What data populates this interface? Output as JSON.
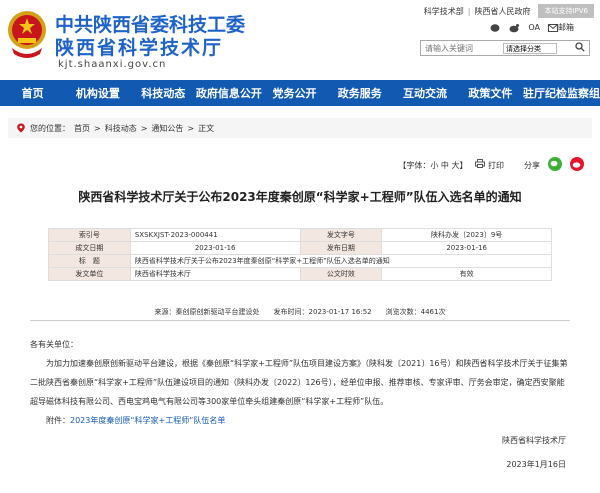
{
  "header": {
    "org_line1": "中共陕西省委科技工委",
    "org_line2": "陕西省科学技术厅",
    "domain": "kjt.shaanxi.gov.cn",
    "top_links": [
      "科学技术部",
      "陕西省人民政府"
    ],
    "ipv6_badge": "本站支持IPV6",
    "icon_labels": [
      "OA",
      "邮箱"
    ],
    "search_placeholder": "请输入关键词",
    "search_scope": "请选择分类"
  },
  "nav": [
    "首页",
    "机构设置",
    "科技动态",
    "政府信息公开",
    "党务公开",
    "政务服务",
    "互动交流",
    "政策文件",
    "驻厅纪检监察组"
  ],
  "breadcrumb": {
    "prefix": "您的位置：",
    "items": [
      "首页",
      "科技动态",
      "通知公告",
      "正文"
    ]
  },
  "tools": {
    "font_label": "【字体：",
    "small": "小",
    "medium": "中",
    "large": "大",
    "font_end": "】",
    "print": "打印",
    "share": "分享"
  },
  "article": {
    "title": "陕西省科学技术厅关于公布2023年度秦创原“科学家+工程师”队伍入选名单的通知",
    "meta_rows": [
      [
        "索引号",
        "SXSKXJST-2023-000441",
        "发文字号",
        "陕科办发〔2023〕9号"
      ],
      [
        "成文日期",
        "2023-01-16",
        "发布日期",
        "2023-01-16"
      ],
      [
        "标　题",
        "陕西省科学技术厅关于公布2023年度秦创原“科学家+工程师”队伍入选名单的通知"
      ],
      [
        "发文单位",
        "陕西省科学技术厅",
        "公文时效",
        "有效"
      ]
    ],
    "source": "来源：秦创原创新驱动平台建设处　　发布时间：2023-01-17 16:52　　浏览次数：4461次",
    "salutation": "各有关单位：",
    "para": "为加力加速秦创原创新驱动平台建设，根据《秦创原“科学家+工程师”队伍项目建设方案》（陕科发〔2021〕16号）和陕西省科学技术厅关于征集第二批陕西省秦创原“科学家+工程师”队伍建设项目的通知（陕科办发〔2022〕126号），经单位申报、推荐审核、专家评审、厅务会审定，确定西安聚能超导磁体科技有限公司、西电宝鸡电气有限公司等300家单位牵头组建秦创原“科学家+工程师”队伍。",
    "attachment_label": "附件：",
    "attachment_link": "2023年度秦创原“科学家+工程师”队伍名单",
    "sign": "陕西省科学技术厅",
    "date": "2023年1月16日"
  }
}
